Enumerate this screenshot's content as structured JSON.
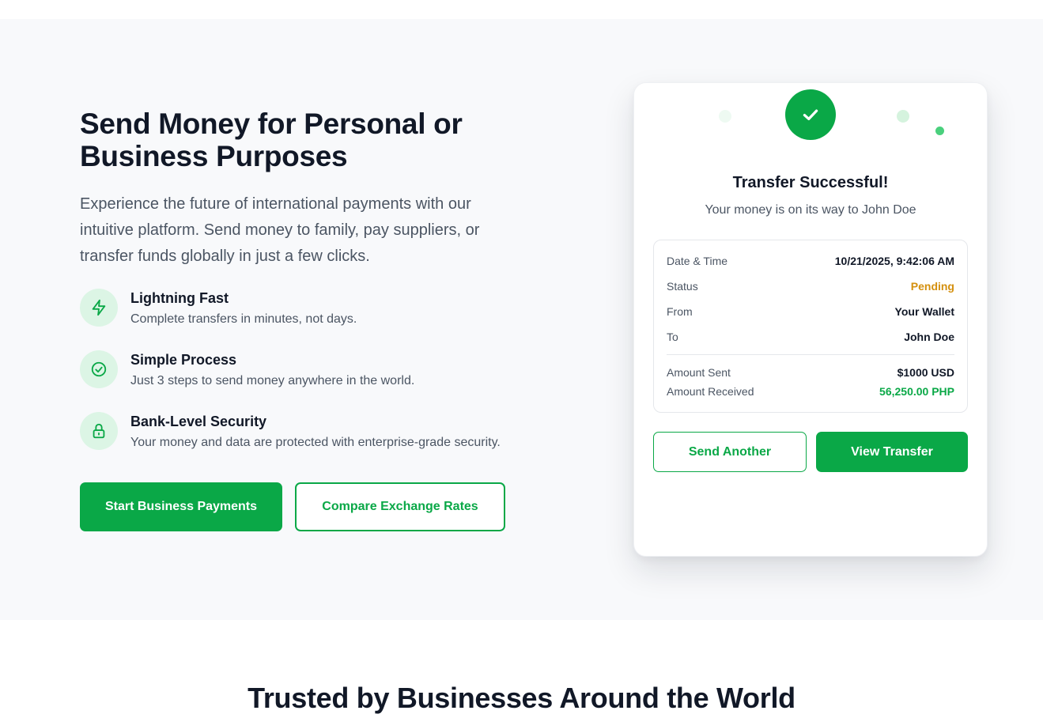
{
  "hero": {
    "headline": "Send Money for Personal or Business Purposes",
    "intro": "Experience the future of international payments with our intuitive platform. Send money to family, pay suppliers, or transfer funds globally in just a few clicks.",
    "features": [
      {
        "icon": "lightning-icon",
        "title": "Lightning Fast",
        "description": "Complete transfers in minutes, not days."
      },
      {
        "icon": "check-circle-icon",
        "title": "Simple Process",
        "description": "Just 3 steps to send money anywhere in the world."
      },
      {
        "icon": "lock-icon",
        "title": "Bank-Level Security",
        "description": "Your money and data are protected with enterprise-grade security."
      }
    ],
    "primary_cta": "Start Business Payments",
    "secondary_cta": "Compare Exchange Rates"
  },
  "card": {
    "icon": "check-icon",
    "title": "Transfer Successful!",
    "subtitle": "Your money is on its way to John Doe",
    "details": {
      "date_label": "Date & Time",
      "date_value": "10/21/2025, 9:42:06 AM",
      "status_label": "Status",
      "status_value": "Pending",
      "from_label": "From",
      "from_value": "Your Wallet",
      "to_label": "To",
      "to_value": "John Doe",
      "sent_label": "Amount Sent",
      "sent_value": "$1000 USD",
      "received_label": "Amount Received",
      "received_value": "56,250.00 PHP"
    },
    "send_another": "Send Another",
    "view_transfer": "View Transfer"
  },
  "trusted": {
    "heading": "Trusted by Businesses Around the World"
  },
  "colors": {
    "accent": "#0aa847",
    "pending": "#d4900f",
    "icon_bg": "#dcf5e5",
    "hero_bg": "#f8f9fb"
  }
}
